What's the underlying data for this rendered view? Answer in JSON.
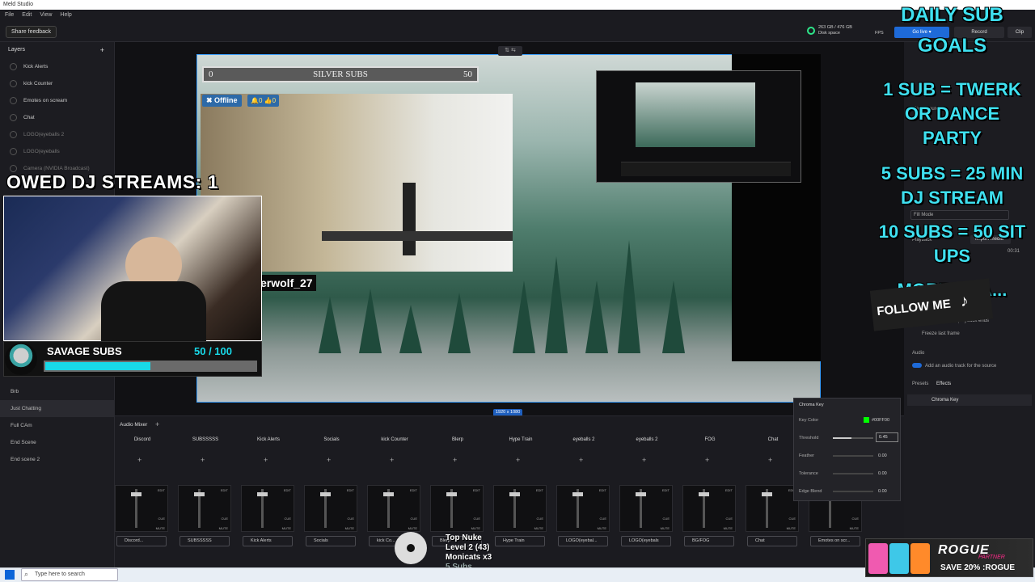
{
  "app": {
    "title": "Meld Studio",
    "menu": [
      "File",
      "Edit",
      "View",
      "Help"
    ],
    "feedback": "Share feedback"
  },
  "top_stats": {
    "disk": "263 GB / 476 GB",
    "disk_label": "Disk space",
    "fps_label": "FPS",
    "go_live": "Go live ▾",
    "record": "Record",
    "clip": "Clip"
  },
  "layers": {
    "title": "Layers",
    "items": [
      "Kick Alerts",
      "kick Counter",
      "Emotes on scream",
      "Chat",
      "LOGO(eyeballs 2",
      "LOGO(eyeballs",
      "Camera (NVIDIA Broadcast)"
    ]
  },
  "scenes": [
    "Brb",
    "Just Chatting",
    "Full CAm",
    "End Scene",
    "End scene 2"
  ],
  "stage": {
    "goal_bar": {
      "left": "0",
      "title": "SILVER SUBS",
      "right": "50"
    },
    "offline": "✖ Offline",
    "counts": "🔔0 👍0",
    "username": "erwolf_27",
    "size": "1920 x 1080"
  },
  "overlay": {
    "owed": "OWED DJ STREAMS: 1",
    "sub_title": "SAVAGE SUBS",
    "sub_count": "50  / 100",
    "sub_progress": 0.5
  },
  "goals": {
    "title": "DAILY SUB GOALS",
    "lines": [
      "1 SUB = TWERK OR DANCE PARTY",
      "5 SUBS = 25 MIN DJ STREAM",
      "10 SUBS = 50 SIT UPS",
      "MORE TBA..."
    ]
  },
  "follow": "FOLLOW ME",
  "mixer": {
    "title": "Audio Mixer",
    "channels": [
      {
        "name": "Discord",
        "source": "Discord..."
      },
      {
        "name": "SUBSSSSS",
        "source": "SUBSSSSS"
      },
      {
        "name": "Kick Alerts",
        "source": "Kick Alerts"
      },
      {
        "name": "Socials",
        "source": "Socials"
      },
      {
        "name": "kick Counter",
        "source": "kick Co..."
      },
      {
        "name": "Blerp",
        "source": "Blerp"
      },
      {
        "name": "Hype Train",
        "source": "Hype Train"
      },
      {
        "name": "eyeballs 2",
        "source": "LOGO(eyebal..."
      },
      {
        "name": "eyeballs 2",
        "source": "LOGO(eyebals"
      },
      {
        "name": "FOG",
        "source": "BG/FOG"
      },
      {
        "name": "Chat",
        "source": "Chat"
      },
      {
        "name": "",
        "source": "Emotes on scr..."
      }
    ],
    "edit": "EDIT",
    "cue": "CUE",
    "mute": "MUTE"
  },
  "chroma": {
    "title": "Chroma Key",
    "key_color_label": "Key Color",
    "key_color_value": "#00FF00",
    "rows": [
      {
        "label": "Threshold",
        "value": "0.45"
      },
      {
        "label": "Feather",
        "value": "0.00"
      },
      {
        "label": "Tolerance",
        "value": "0.00"
      },
      {
        "label": "Edge Blend",
        "value": "0.00"
      }
    ]
  },
  "right_panel": {
    "media_source": "Media source",
    "fill_mode": "Fill Mode",
    "playback": "Playback",
    "import_media": "Import media",
    "time": "00:31",
    "layer_end": "Hide layer when playback ends",
    "freeze": "Freeze last frame",
    "audio": "Audio",
    "add_audio": "Add an audio track for the source",
    "presets": "Presets",
    "effects": "Effects",
    "effect_item": "Chroma Key"
  },
  "nuke": {
    "line1": "Top Nuke",
    "line2": "Level 2  (43)",
    "line3": "Monicats x3",
    "line4": "5 Subs"
  },
  "taskbar": {
    "search": "Type here to search"
  },
  "rogue": {
    "logo": "ROGUE",
    "partner": "PARTNER",
    "save": "SAVE 20% :ROGUE"
  },
  "colors": {
    "accent": "#3aa0ff",
    "cyan": "#18d9e8",
    "key": "#00ff00"
  }
}
